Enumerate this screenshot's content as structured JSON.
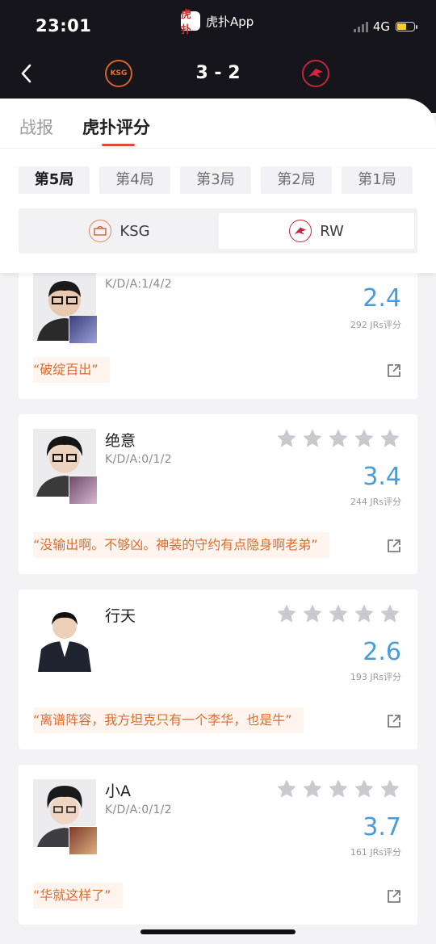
{
  "status": {
    "time": "23:01",
    "app_name": "虎扑App",
    "app_logo_text": "虎扑",
    "network": "4G",
    "battery_level": 0.55
  },
  "match": {
    "score": "3 - 2",
    "left_team_logo": "KSG",
    "right_team_logo": "RW"
  },
  "tabs": [
    {
      "label": "战报"
    },
    {
      "label": "虎扑评分"
    }
  ],
  "rounds": [
    {
      "label": "第5局"
    },
    {
      "label": "第4局"
    },
    {
      "label": "第3局"
    },
    {
      "label": "第2局"
    },
    {
      "label": "第1局"
    }
  ],
  "teams": [
    {
      "label": "KSG"
    },
    {
      "label": "RW"
    }
  ],
  "players": [
    {
      "name": "",
      "kda": "K/D/A:1/4/2",
      "rating": "2.4",
      "count": "292 JRs评分",
      "comment": "“破绽百出”"
    },
    {
      "name": "绝意",
      "kda": "K/D/A:0/1/2",
      "rating": "3.4",
      "count": "244 JRs评分",
      "comment": "“没输出啊。不够凶。神装的守约有点隐身啊老弟”"
    },
    {
      "name": "行天",
      "kda": "",
      "rating": "2.6",
      "count": "193 JRs评分",
      "comment": "“离谱阵容，我方坦克只有一个李华，也是牛”"
    },
    {
      "name": "小A",
      "kda": "K/D/A:0/1/2",
      "rating": "3.7",
      "count": "161 JRs评分",
      "comment": "“华就这样了”"
    }
  ],
  "colors": {
    "accent": "#e04a3a",
    "rating": "#4a9cd9",
    "comment_text": "#de6b2f",
    "comment_bg": "#fff5ee"
  },
  "icons": {
    "back": "chevron-left-icon",
    "share": "share-icon",
    "star": "star-icon"
  }
}
